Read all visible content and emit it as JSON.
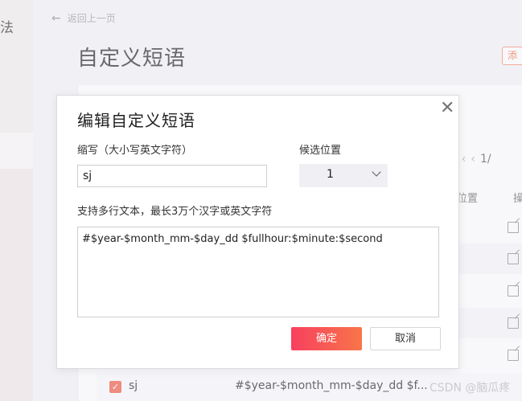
{
  "sidebar": {
    "partial_glyph": "法"
  },
  "header": {
    "back_label": "返回上一页",
    "title": "自定义短语",
    "add_label": "添"
  },
  "list": {
    "pager_text": "1/",
    "col_position": "位置",
    "col_actions": "操",
    "row": {
      "abbr": "sj",
      "text": "#$year-$month_mm-$day_dd $f..."
    },
    "watermark": "CSDN @脑瓜疼"
  },
  "dialog": {
    "title": "编辑自定义短语",
    "abbr_label": "缩写（大小写英文字符）",
    "abbr_value": "sj",
    "position_label": "候选位置",
    "position_value": "1",
    "text_label": "支持多行文本，最长3万个汉字或英文字符",
    "text_value": "#$year-$month_mm-$day_dd $fullhour:$minute:$second",
    "ok_label": "确定",
    "cancel_label": "取消"
  },
  "colors": {
    "accent": "#f26a4a",
    "ok_gradient_start": "#f8405f",
    "ok_gradient_end": "#f8754a"
  }
}
